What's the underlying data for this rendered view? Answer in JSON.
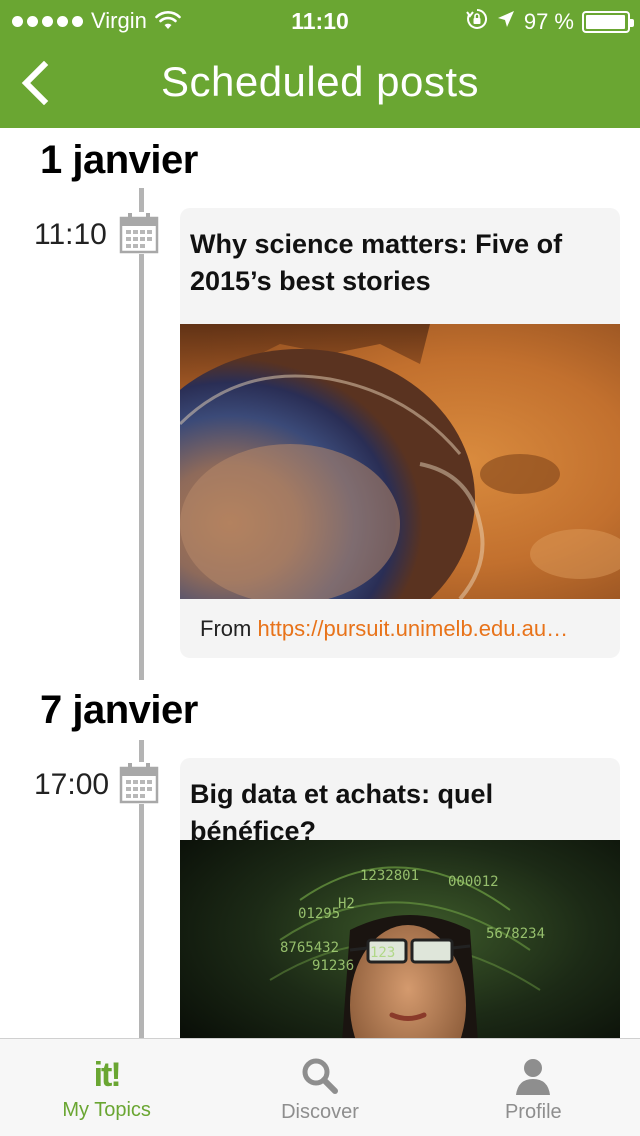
{
  "status_bar": {
    "carrier": "Virgin",
    "time": "11:10",
    "battery": "97 %",
    "battery_level": 0.97
  },
  "nav": {
    "title": "Scheduled posts"
  },
  "sections": [
    {
      "date": "1 janvier",
      "time": "11:10",
      "post": {
        "title_line1": "Why science matters: Five of",
        "title_line2": "2015’s best stories",
        "source_prefix": "From ",
        "source_url": "https://pursuit.unimelb.edu.au…"
      }
    },
    {
      "date": "7 janvier",
      "time": "17:00",
      "post": {
        "title_line1": "Big data et achats: quel bénéfice?"
      }
    }
  ],
  "image_text": {
    "n1": "1232801",
    "n2": "000012",
    "n3": "01295",
    "n4": "H2",
    "n5": "5678234",
    "n6": "8765432",
    "n7": "91236",
    "n8": "123"
  },
  "tabs": [
    {
      "label": "My Topics",
      "icon": "it-logo-icon",
      "logo_text": "it!"
    },
    {
      "label": "Discover",
      "icon": "search-icon"
    },
    {
      "label": "Profile",
      "icon": "person-icon"
    }
  ],
  "colors": {
    "brand": "#6aa632",
    "link": "#e8731a",
    "timeline": "#b4b4b4",
    "card_bg": "#f4f4f4"
  }
}
